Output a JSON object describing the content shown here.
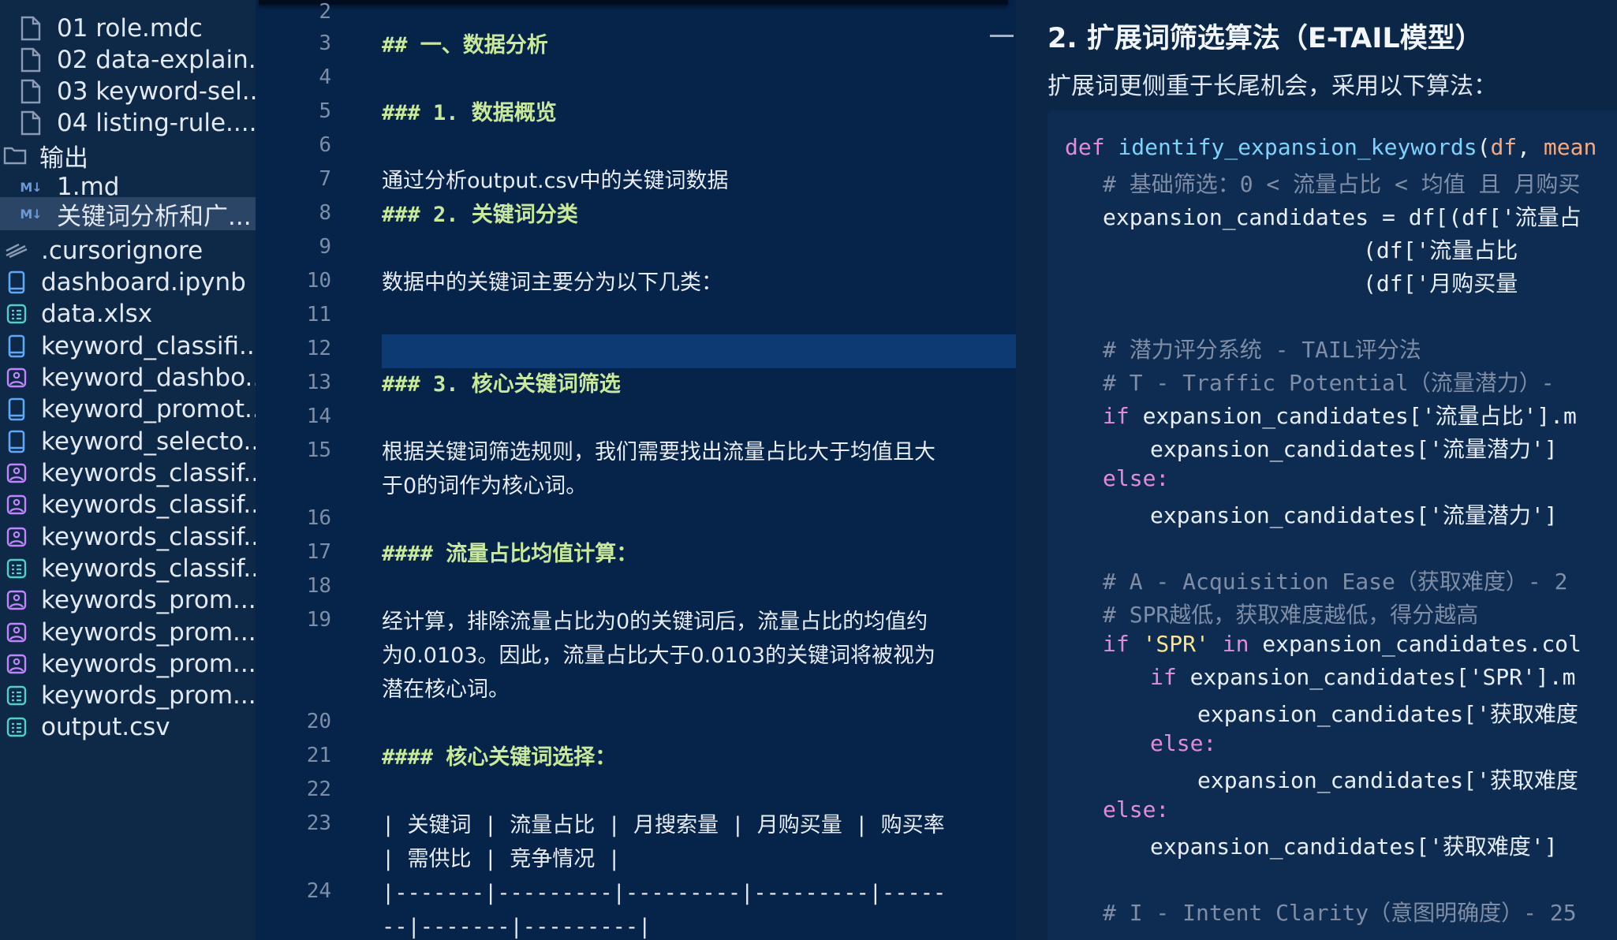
{
  "sidebar": {
    "items": [
      {
        "label": "01 role.mdc",
        "icon": "file-icon"
      },
      {
        "label": "02 data-explain...",
        "icon": "file-icon"
      },
      {
        "label": "03 keyword-sel...",
        "icon": "file-icon"
      },
      {
        "label": "04 listing-rule....",
        "icon": "file-icon"
      },
      {
        "label": "输出",
        "icon": "folder-icon"
      },
      {
        "label": "1.md",
        "icon": "markdown-icon",
        "badge": "M↓"
      },
      {
        "label": "关键词分析和广...",
        "icon": "markdown-icon",
        "badge": "M↓"
      },
      {
        "label": ".cursorignore",
        "icon": "ignore-icon"
      },
      {
        "label": "dashboard.ipynb",
        "icon": "notebook-icon"
      },
      {
        "label": "data.xlsx",
        "icon": "spreadsheet-icon"
      },
      {
        "label": "keyword_classifi...",
        "icon": "notebook-icon"
      },
      {
        "label": "keyword_dashbo...",
        "icon": "image-icon"
      },
      {
        "label": "keyword_promot...",
        "icon": "notebook-icon"
      },
      {
        "label": "keyword_selecto...",
        "icon": "notebook-icon"
      },
      {
        "label": "keywords_classif...",
        "icon": "image-icon"
      },
      {
        "label": "keywords_classif...",
        "icon": "image-icon"
      },
      {
        "label": "keywords_classif...",
        "icon": "image-icon"
      },
      {
        "label": "keywords_classif...",
        "icon": "spreadsheet-icon"
      },
      {
        "label": "keywords_prom...",
        "icon": "image-icon"
      },
      {
        "label": "keywords_prom...",
        "icon": "image-icon"
      },
      {
        "label": "keywords_prom...",
        "icon": "image-icon"
      },
      {
        "label": "keywords_prom...",
        "icon": "spreadsheet-icon"
      },
      {
        "label": "output.csv",
        "icon": "spreadsheet-icon"
      }
    ]
  },
  "editor": {
    "line_numbers": [
      "2",
      "3",
      "4",
      "5",
      "6",
      "7",
      "8",
      "9",
      "10",
      "11",
      "12",
      "13",
      "14",
      "15",
      "16",
      "17",
      "18",
      "19",
      "20",
      "21",
      "22",
      "23",
      "24"
    ],
    "lines": [
      "## 一、数据分析",
      "### 1. 数据概览",
      "通过分析output.csv中的关键词数据",
      "### 2. 关键词分类",
      "数据中的关键词主要分为以下几类：",
      "### 3. 核心关键词筛选",
      "根据关键词筛选规则，我们需要找出流量占比大于均值且大",
      "于0的词作为核心词。",
      "#### 流量占比均值计算：",
      "经计算，排除流量占比为0的关键词后，流量占比的均值约",
      "为0.0103。因此，流量占比大于0.0103的关键词将被视为",
      "潜在核心词。",
      "#### 核心关键词选择：",
      "| 关键词 | 流量占比 | 月搜索量 | 月购买量 | 购买率",
      "| 需供比 | 竞争情况 |",
      "|-------|---------|---------|---------|-----",
      "--|-------|---------|"
    ]
  },
  "preview": {
    "title": "2. 扩展词筛选算法（E-TAIL模型）",
    "intro": "扩展词更侧重于长尾机会，采用以下算法：",
    "code": {
      "def": "def",
      "fn_name": "identify_expansion_keywords",
      "paren_open": "(",
      "param_df": "df",
      "comma": ", ",
      "param_mean": "mean",
      "c1": "# 基础筛选：0 < 流量占比 < 均值 且 月购买",
      "l3": "expansion_candidates = df[(df['流量占",
      "l4": "(df['流量占比",
      "l5": "(df['月购买量",
      "c2": "# 潜力评分系统 - TAIL评分法",
      "c3": "# T - Traffic Potential（流量潜力）-",
      "if": "if",
      "l8": " expansion_candidates['流量占比'].m",
      "l9": "expansion_candidates['流量潜力']",
      "else": "else:",
      "l11": "expansion_candidates['流量潜力']",
      "c4": "# A - Acquisition Ease（获取难度）- 2",
      "c5": "# SPR越低，获取难度越低，得分越高",
      "spr": "'SPR'",
      "in": "in",
      "l14": " expansion_candidates.col",
      "l15": " expansion_candidates['SPR'].m",
      "l16": "expansion_candidates['获取难度",
      "l18": "expansion_candidates['获取难度",
      "l20": "expansion_candidates['获取难度']",
      "c6": "# I - Intent Clarity（意图明确度）- 25"
    }
  }
}
